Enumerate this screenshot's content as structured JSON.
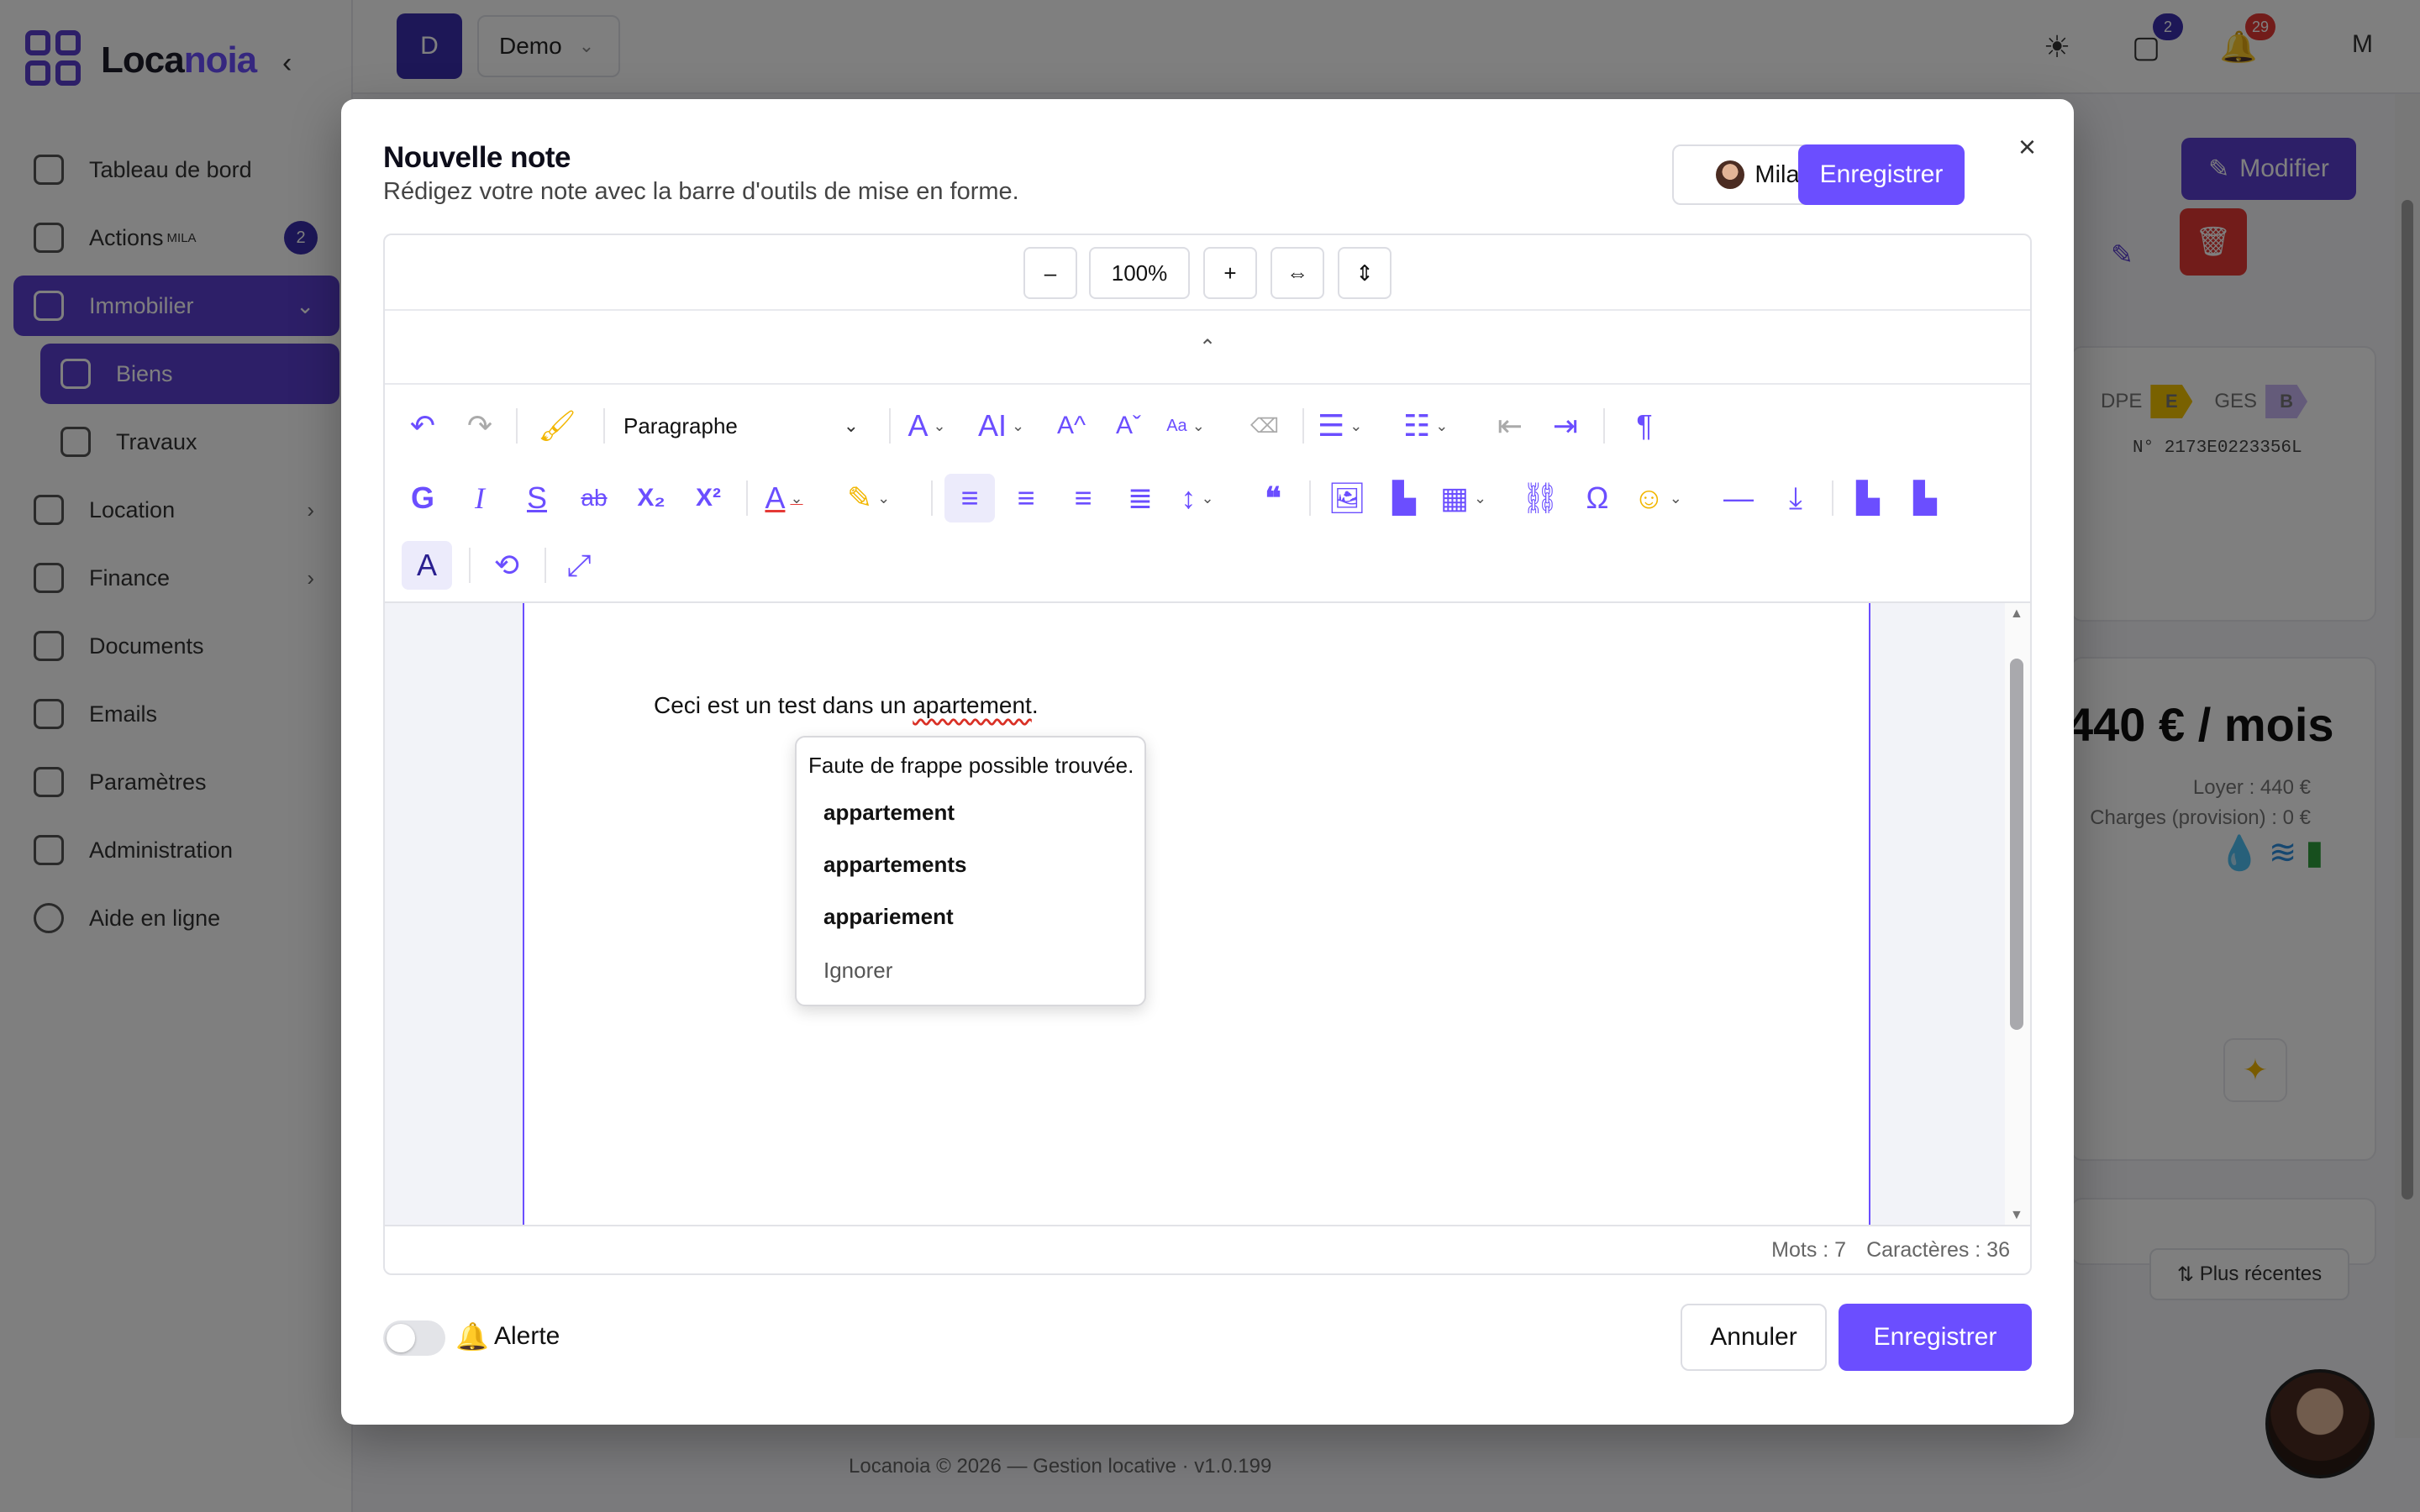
{
  "app": {
    "name_part1": "Loca",
    "name_part2": "noia",
    "collapse_icon": "‹"
  },
  "sidebar": {
    "items": [
      {
        "label": "Tableau de bord"
      },
      {
        "label": "Actions",
        "sup": "MILA",
        "badge": "2"
      },
      {
        "label": "Immobilier"
      },
      {
        "label": "Biens"
      },
      {
        "label": "Travaux"
      },
      {
        "label": "Location"
      },
      {
        "label": "Finance"
      },
      {
        "label": "Documents"
      },
      {
        "label": "Emails"
      },
      {
        "label": "Paramètres"
      },
      {
        "label": "Administration"
      },
      {
        "label": "Aide en ligne"
      }
    ]
  },
  "topbar": {
    "org_initial": "D",
    "org_name": "Demo",
    "tasks_badge": "2",
    "notifications_badge": "29",
    "user_initial": "M"
  },
  "background": {
    "modify_label": "Modifier",
    "dpe_label": "DPE",
    "dpe_value": "E",
    "ges_label": "GES",
    "ges_value": "B",
    "dpe_number": "N° 2173E0223356L",
    "price": "440 € / mois",
    "loyer": "Loyer : 440 €",
    "charges": "Charges (provision) : 0 €",
    "sort_label": "Plus récentes",
    "footer": "Locanoia © 2026 — Gestion locative · v1.0.199"
  },
  "modal": {
    "title": "Nouvelle note",
    "subtitle": "Rédigez votre note avec la barre d'outils de mise en forme.",
    "assistant_name": "Mila",
    "save_label": "Enregistrer",
    "close_icon": "×",
    "zoom": {
      "minus": "–",
      "value": "100%",
      "plus": "+"
    },
    "collapse_icon": "⌃",
    "toolbar": {
      "block_format": "Paragraphe"
    },
    "document": {
      "text_before": "Ceci est un test dans un ",
      "misspelled_word": "apartement",
      "text_after": "."
    },
    "spellcheck": {
      "header": "Faute de frappe possible trouvée.",
      "suggestions": [
        "appartement",
        "appartements",
        "appariement"
      ],
      "ignore_label": "Ignorer"
    },
    "status": {
      "words": "Mots : 7",
      "characters": "Caractères : 36"
    },
    "alert_label": "Alerte",
    "alert_enabled": false,
    "cancel_label": "Annuler",
    "footer_save_label": "Enregistrer"
  },
  "colors": {
    "accent": "#6b4eff",
    "brand_dark": "#5b3fd1",
    "danger": "#e53935"
  }
}
